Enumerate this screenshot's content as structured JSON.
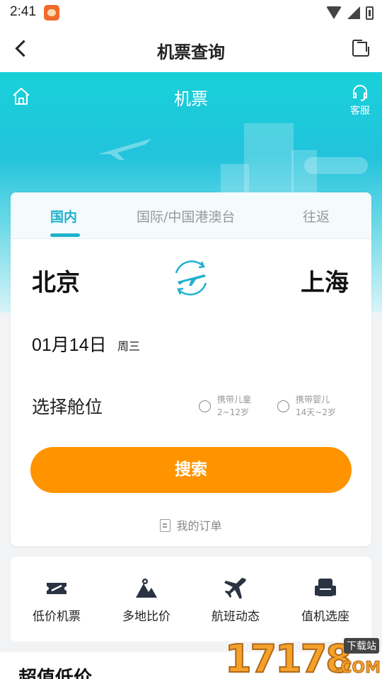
{
  "status_bar": {
    "time": "2:41"
  },
  "nav": {
    "title": "机票查询"
  },
  "banner": {
    "title": "机票",
    "customer_service_label": "客服"
  },
  "booking": {
    "tabs": [
      {
        "label": "国内",
        "active": true
      },
      {
        "label": "国际/中国港澳台",
        "active": false
      },
      {
        "label": "往返",
        "active": false
      }
    ],
    "from_city": "北京",
    "to_city": "上海",
    "date": "01月14日",
    "weekday": "周三",
    "cabin_label": "选择舱位",
    "options": [
      {
        "line1": "携带儿童",
        "line2": "2~12岁",
        "checked": false
      },
      {
        "line1": "携带婴儿",
        "line2": "14天~2岁",
        "checked": false
      }
    ],
    "search_label": "搜索",
    "orders_label": "我的订单"
  },
  "features": [
    {
      "label": "低价机票",
      "icon": "ticket-icon"
    },
    {
      "label": "多地比价",
      "icon": "mountain-icon"
    },
    {
      "label": "航班动态",
      "icon": "airplane-icon"
    },
    {
      "label": "值机选座",
      "icon": "seat-icon"
    }
  ],
  "section": {
    "title": "超值低价"
  },
  "watermark": {
    "number": "17178",
    "tag": "下载站",
    "suffix": ".COM"
  },
  "colors": {
    "accent": "#1fb1ce",
    "search_button": "#ff9400",
    "banner_top": "#18d1d9"
  }
}
